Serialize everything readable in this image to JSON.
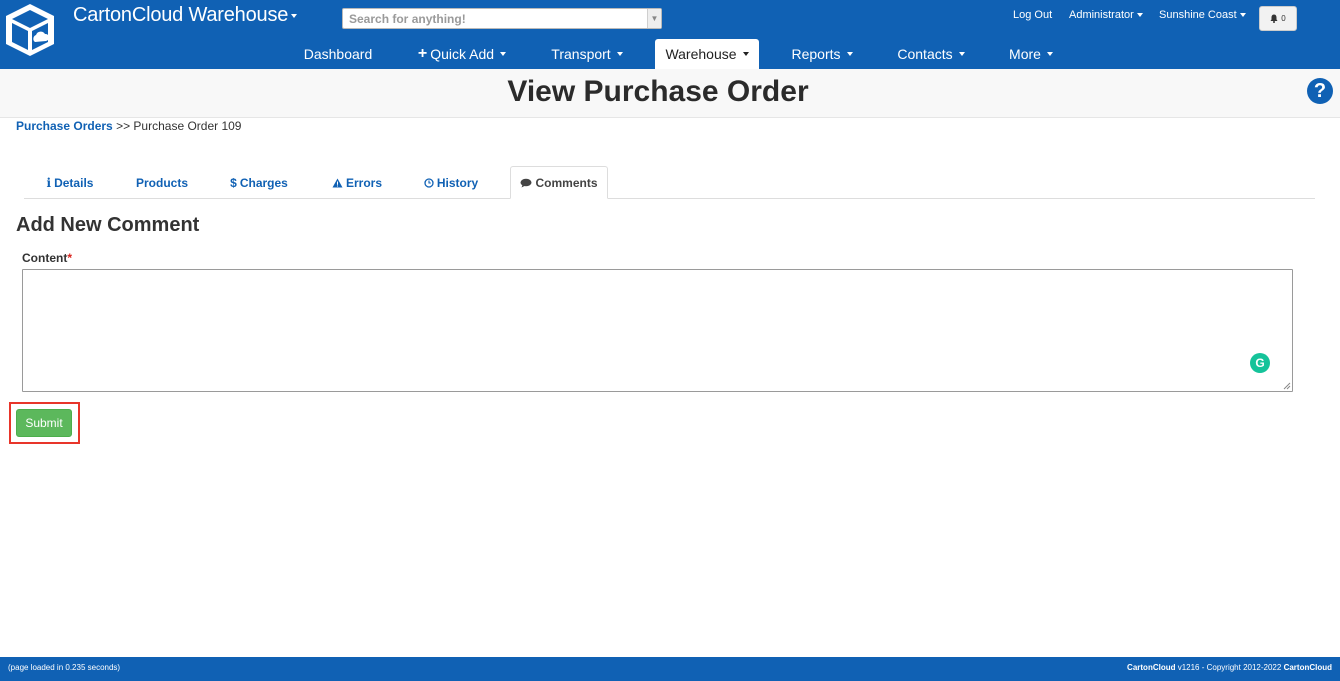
{
  "header": {
    "app_title": "CartonCloud Warehouse",
    "search_placeholder": "Search for anything!",
    "logout": "Log Out",
    "user": "Administrator",
    "location": "Sunshine Coast",
    "notification_count": "0"
  },
  "nav": {
    "items": [
      {
        "label": "Dashboard",
        "caret": false
      },
      {
        "label": "Quick Add",
        "icon": "plus-icon",
        "caret": true
      },
      {
        "label": "Transport",
        "caret": true
      },
      {
        "label": "Warehouse",
        "caret": true,
        "active": true
      },
      {
        "label": "Reports",
        "caret": true
      },
      {
        "label": "Contacts",
        "caret": true
      },
      {
        "label": "More",
        "caret": true
      }
    ]
  },
  "page": {
    "title": "View Purchase Order"
  },
  "breadcrumb": {
    "link": "Purchase Orders",
    "separator": ">>",
    "current": "Purchase Order 109"
  },
  "tabs": [
    {
      "label": "Details",
      "icon": "info-icon"
    },
    {
      "label": "Products",
      "icon": ""
    },
    {
      "label": "Charges",
      "icon": "dollar-icon"
    },
    {
      "label": "Errors",
      "icon": "warning-icon"
    },
    {
      "label": "History",
      "icon": "clock-icon"
    },
    {
      "label": "Comments",
      "icon": "comment-icon",
      "active": true
    }
  ],
  "form": {
    "section_title": "Add New Comment",
    "content_label": "Content",
    "required_mark": "*",
    "content_value": "",
    "submit_label": "Submit"
  },
  "footer": {
    "load_time": "(page loaded in 0.235 seconds)",
    "brand": "CartonCloud",
    "version_text": " v1216 - Copyright 2012-2022 ",
    "brand2": "CartonCloud"
  },
  "colors": {
    "brand_blue": "#1061b4",
    "submit_green": "#5cb85c",
    "highlight_red": "#e8352a"
  }
}
